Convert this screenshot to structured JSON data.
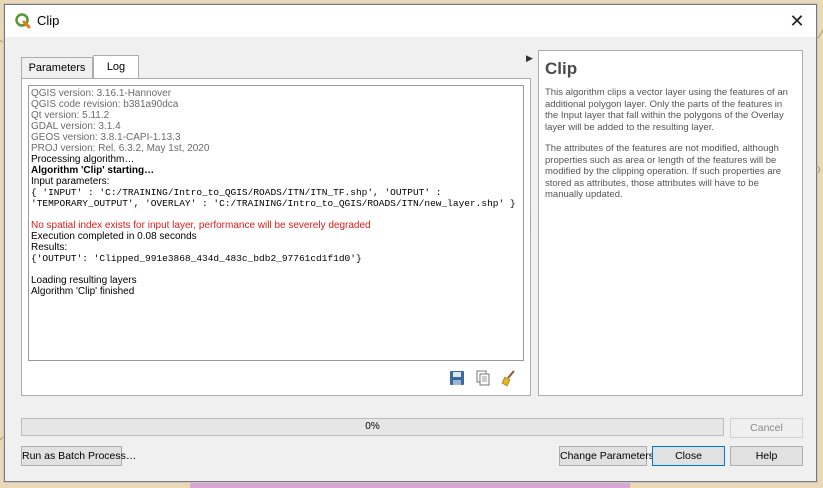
{
  "window": {
    "title": "Clip"
  },
  "tabs": [
    {
      "label": "Parameters",
      "active": false
    },
    {
      "label": "Log",
      "active": true
    }
  ],
  "log": {
    "lines": [
      {
        "text": "QGIS version: 3.16.1-Hannover",
        "style": "grey"
      },
      {
        "text": "QGIS code revision: b381a90dca",
        "style": "grey"
      },
      {
        "text": "Qt version: 5.11.2",
        "style": "grey"
      },
      {
        "text": "GDAL version: 3.1.4",
        "style": "grey"
      },
      {
        "text": "GEOS version: 3.8.1-CAPI-1.13.3",
        "style": "grey"
      },
      {
        "text": "PROJ version: Rel. 6.3.2, May 1st, 2020",
        "style": "grey"
      },
      {
        "text": "Processing algorithm…",
        "style": "normal"
      },
      {
        "text": "Algorithm 'Clip' starting…",
        "style": "bold"
      },
      {
        "text": "Input parameters:",
        "style": "normal"
      },
      {
        "text": "{ 'INPUT' : 'C:/TRAINING/Intro_to_QGIS/ROADS/ITN/ITN_TF.shp', 'OUTPUT' :",
        "style": "mono"
      },
      {
        "text": "'TEMPORARY_OUTPUT', 'OVERLAY' : 'C:/TRAINING/Intro_to_QGIS/ROADS/ITN/new_layer.shp' }",
        "style": "mono"
      },
      {
        "text": "",
        "style": "gap"
      },
      {
        "text": "No spatial index exists for input layer, performance will be severely degraded",
        "style": "red"
      },
      {
        "text": "Execution completed in 0.08 seconds",
        "style": "normal"
      },
      {
        "text": "Results:",
        "style": "normal"
      },
      {
        "text": "{'OUTPUT': 'Clipped_991e3868_434d_483c_bdb2_97761cd1f1d0'}",
        "style": "mono"
      },
      {
        "text": "",
        "style": "gap"
      },
      {
        "text": "Loading resulting layers",
        "style": "normal"
      },
      {
        "text": "Algorithm 'Clip' finished",
        "style": "normal"
      }
    ]
  },
  "log_tools": {
    "save_icon": "save-icon",
    "copy_icon": "copy-icon",
    "clear_icon": "broom-icon"
  },
  "help": {
    "title": "Clip",
    "paragraphs": [
      "This algorithm clips a vector layer using the features of an additional polygon layer. Only the parts of the features in the Input layer that fall within the polygons of the Overlay layer will be added to the resulting layer.",
      "The attributes of the features are not modified, although properties such as area or length of the features will be modified by the clipping operation. If such properties are stored as attributes, those attributes will have to be manually updated."
    ]
  },
  "progress": {
    "value": 0,
    "label": "0%"
  },
  "buttons": {
    "cancel": "Cancel",
    "batch": "Run as Batch Process…",
    "change_params": "Change Parameters",
    "close": "Close",
    "help": "Help"
  },
  "colors": {
    "progress_fill": "#06b025",
    "default_button_border": "#0078d7",
    "warning": "#e01b1b"
  }
}
